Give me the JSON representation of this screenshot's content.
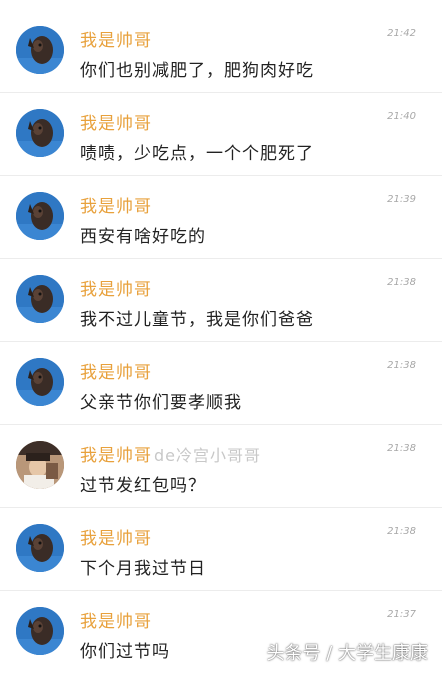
{
  "messages": [
    {
      "name": "我是帅哥",
      "time": "21:42",
      "text": "你们也别减肥了，肥狗肉好吃"
    },
    {
      "name": "我是帅哥",
      "time": "21:40",
      "text": "啧啧，少吃点，一个个肥死了"
    },
    {
      "name": "我是帅哥",
      "time": "21:39",
      "text": "西安有啥好吃的"
    },
    {
      "name": "我是帅哥",
      "time": "21:38",
      "text": "我不过儿童节，我是你们爸爸"
    },
    {
      "name": "我是帅哥",
      "time": "21:38",
      "text": "父亲节你们要孝顺我"
    },
    {
      "name": "我是帅哥",
      "name_suffix": "de冷宫小哥哥",
      "time": "21:38",
      "text": "过节发红包吗？"
    },
    {
      "name": "我是帅哥",
      "time": "21:38",
      "text": "下个月我过节日"
    },
    {
      "name": "我是帅哥",
      "time": "21:37",
      "text": "你们过节吗"
    }
  ],
  "watermark": "头条号 / 大学生康康"
}
